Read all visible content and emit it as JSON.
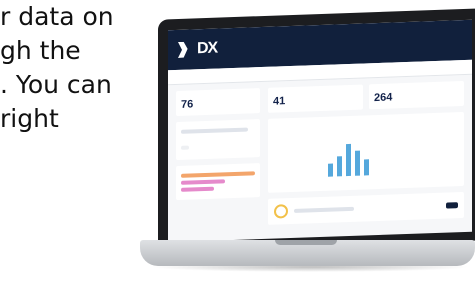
{
  "intro_text": {
    "lines": [
      "r data on",
      "gh the",
      ". You can",
      "right"
    ]
  },
  "app": {
    "header_title": "",
    "subheader_label": "",
    "subheader_link": "",
    "brand": "DX"
  },
  "dashboard": {
    "left": {
      "title": "",
      "value": "76",
      "list_chip": ""
    },
    "stats": [
      {
        "label": "",
        "value": "41"
      },
      {
        "label": "",
        "value": "264"
      }
    ],
    "chart_bars": [
      0.35,
      0.55,
      0.9,
      0.7,
      0.45
    ],
    "cta_label": ""
  },
  "colors": {
    "header": "#11203c",
    "accent_bar_orange": "#f3a56b",
    "accent_bar_pink": "#e58acb",
    "chart_bar": "#55a8dc"
  }
}
